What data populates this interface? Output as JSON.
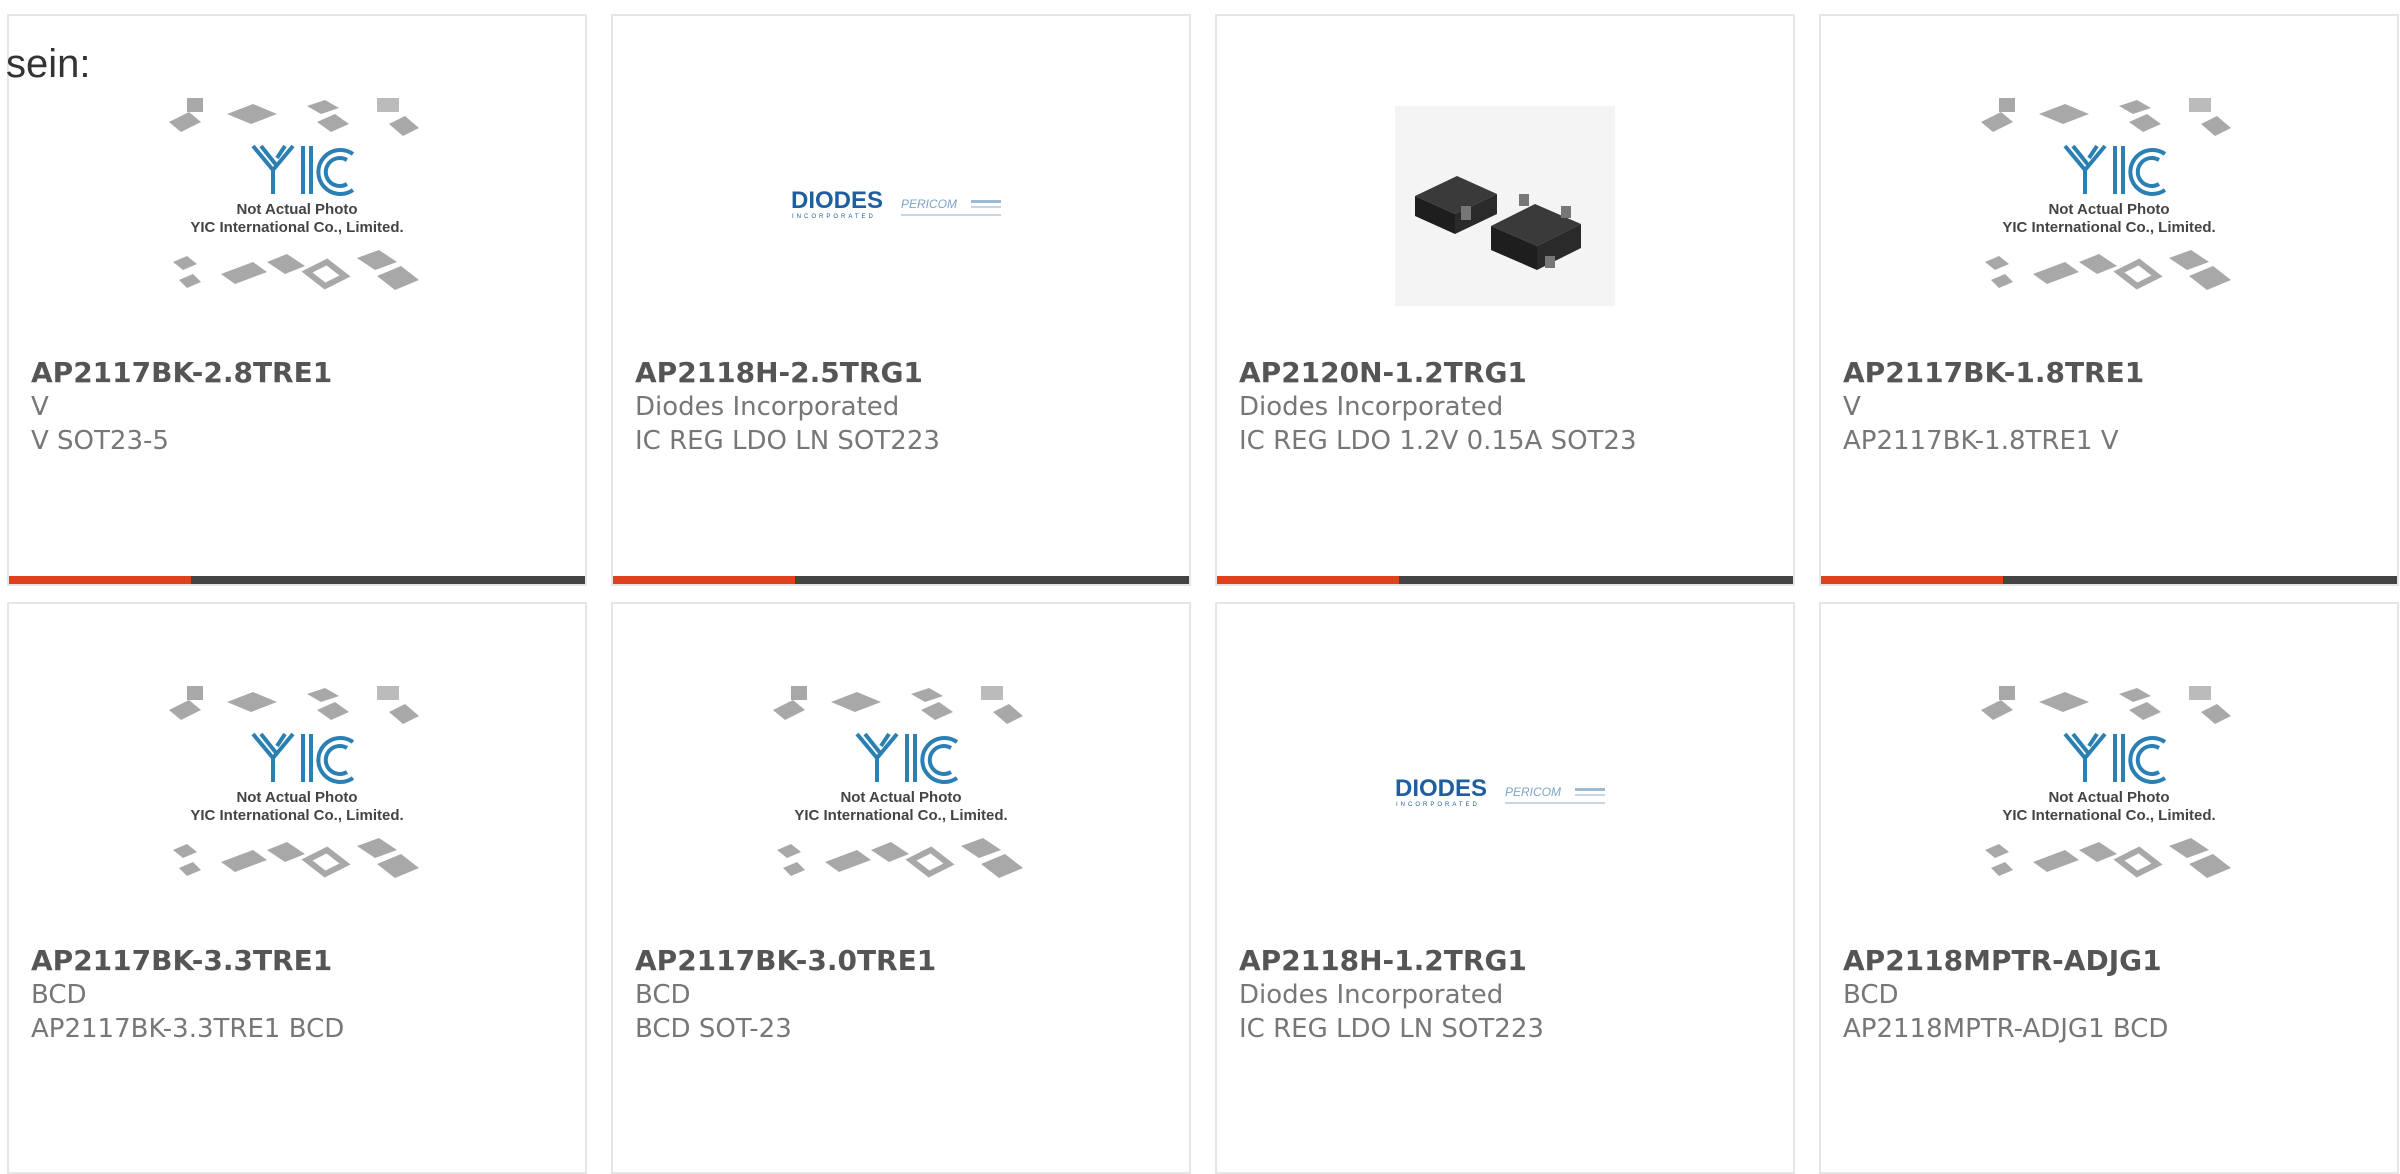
{
  "intro_text": "sein:",
  "brand_colors": {
    "accent": "#e0401b",
    "bar": "#444444",
    "yic_blue": "#2a7fb3",
    "diodes_blue": "#1f5fa0"
  },
  "placeholder": {
    "line1": "Not Actual Photo",
    "line2": "YIC International Co., Limited."
  },
  "diodes_logo": {
    "brand": "DIODES",
    "tagline": "INCORPORATED",
    "partner": "PERICOM"
  },
  "products": [
    {
      "part": "AP2117BK-2.8TRE1",
      "brand": "V",
      "desc": "V SOT23-5",
      "image": "yic-placeholder"
    },
    {
      "part": "AP2118H-2.5TRG1",
      "brand": "Diodes Incorporated",
      "desc": "IC REG LDO LN SOT223",
      "image": "diodes-logo"
    },
    {
      "part": "AP2120N-1.2TRG1",
      "brand": "Diodes Incorporated",
      "desc": "IC REG LDO 1.2V 0.15A SOT23",
      "image": "sot23-photo"
    },
    {
      "part": "AP2117BK-1.8TRE1",
      "brand": "V",
      "desc": "AP2117BK-1.8TRE1 V",
      "image": "yic-placeholder"
    },
    {
      "part": "AP2117BK-3.3TRE1",
      "brand": "BCD",
      "desc": "AP2117BK-3.3TRE1 BCD",
      "image": "yic-placeholder"
    },
    {
      "part": "AP2117BK-3.0TRE1",
      "brand": "BCD",
      "desc": "BCD SOT-23",
      "image": "yic-placeholder"
    },
    {
      "part": "AP2118H-1.2TRG1",
      "brand": "Diodes Incorporated",
      "desc": "IC REG LDO LN SOT223",
      "image": "diodes-logo"
    },
    {
      "part": "AP2118MPTR-ADJG1",
      "brand": "BCD",
      "desc": "AP2118MPTR-ADJG1 BCD",
      "image": "yic-placeholder"
    }
  ]
}
